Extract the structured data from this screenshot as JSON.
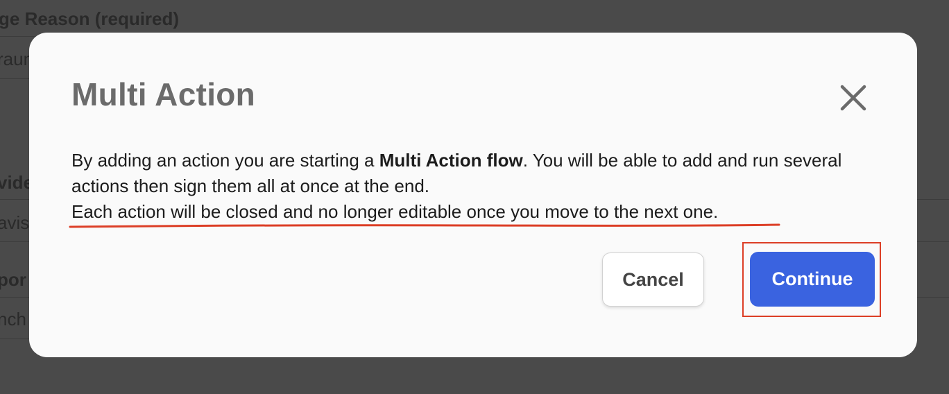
{
  "background": {
    "reason_label": "ge Reason (required)",
    "reason_value": "raun",
    "provider_label": "vide",
    "provider_value": "avis",
    "report_label": "por",
    "report_value": "nch"
  },
  "modal": {
    "title": "Multi Action",
    "body_prefix": "By adding an action you are starting a ",
    "body_bold": "Multi Action flow",
    "body_suffix": ". You will be able to add and run several actions then sign them all at once at the end.",
    "body_note": "Each action will be closed and no longer editable once you move to the next one.",
    "cancel_label": "Cancel",
    "continue_label": "Continue"
  },
  "icons": {
    "close": "close-icon"
  },
  "colors": {
    "overlay": "#4a4a4a",
    "modal_bg": "#fafafa",
    "title": "#6b6b6b",
    "primary_button": "#3a63e0",
    "annotation": "#dc3e26"
  }
}
